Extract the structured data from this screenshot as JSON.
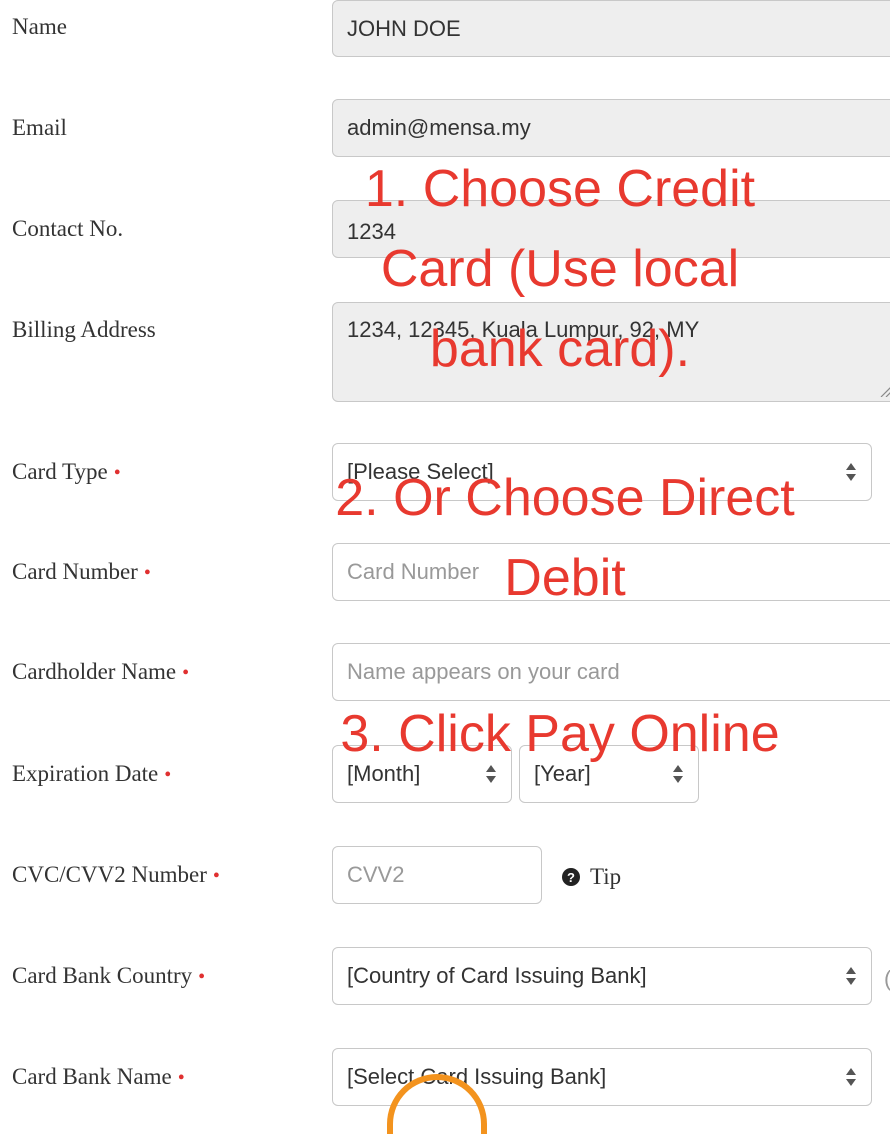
{
  "form": {
    "name": {
      "label": "Name",
      "value": "JOHN DOE"
    },
    "email": {
      "label": "Email",
      "value": "admin@mensa.my"
    },
    "contact": {
      "label": "Contact No.",
      "value": "1234"
    },
    "billing": {
      "label": "Billing Address",
      "value": "1234, 12345, Kuala Lumpur, 92, MY"
    },
    "card_type": {
      "label": "Card Type",
      "selected": "[Please Select]"
    },
    "card_number": {
      "label": "Card Number",
      "placeholder": "Card Number"
    },
    "cardholder": {
      "label": "Cardholder Name",
      "placeholder": "Name appears on your card"
    },
    "expiration": {
      "label": "Expiration Date",
      "month": "[Month]",
      "year": "[Year]"
    },
    "cvv": {
      "label": "CVC/CVV2 Number",
      "placeholder": "CVV2",
      "tip": "Tip"
    },
    "bank_country": {
      "label": "Card Bank Country",
      "selected": "[Country of Card Issuing Bank]"
    },
    "bank_name": {
      "label": "Card Bank Name",
      "selected": "[Select Card Issuing Bank]"
    },
    "required_mark": "•"
  },
  "annotations": {
    "step1_line1": "1. Choose Credit",
    "step1_line2": "Card (Use local",
    "step1_line3": "bank card).",
    "step2_line1": "2. Or Choose Direct",
    "step2_line2": "Debit",
    "step3": "3. Click Pay Online"
  },
  "colors": {
    "annotation": "#e8392f",
    "required": "#e03030",
    "readonly_bg": "#eeeeee",
    "accent_orange": "#f3931e"
  }
}
